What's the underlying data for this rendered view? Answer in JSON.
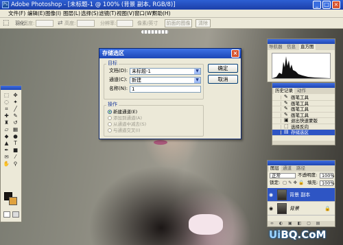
{
  "window": {
    "title": "Adobe Photoshop - [未标题-1 @ 100% (背景 副本, RGB/8)]",
    "app_icon": "ps-logo-icon"
  },
  "menu": [
    "文件(F)",
    "编辑(E)",
    "图像(I)",
    "图层(L)",
    "选择(S)",
    "滤镜(T)",
    "视图(V)",
    "窗口(W)",
    "帮助(H)"
  ],
  "options_bar": {
    "feather_label": "羽化:",
    "feather_value": "0 px",
    "width_label": "宽度:",
    "height_label": "高度:",
    "resolution_label": "分辨率:",
    "resolution_unit": "像素/英寸",
    "front_image_button": "前面的图像",
    "clear_button": "清除"
  },
  "navigator_panel": {
    "tabs": [
      "导航器",
      "信息",
      "直方图"
    ],
    "active_tab": "直方图"
  },
  "history_panel": {
    "tabs": [
      "历史记录",
      "动作"
    ],
    "items": [
      {
        "label": "画笔工具",
        "icon": "brush-icon"
      },
      {
        "label": "画笔工具",
        "icon": "brush-icon"
      },
      {
        "label": "画笔工具",
        "icon": "brush-icon"
      },
      {
        "label": "画笔工具",
        "icon": "brush-icon"
      },
      {
        "label": "退出快速蒙版",
        "icon": "mask-icon"
      },
      {
        "label": "选择反向",
        "icon": "selection-icon"
      },
      {
        "label": "存储选区",
        "icon": "save-icon"
      }
    ],
    "selected_index": 6
  },
  "layers_panel": {
    "tabs": [
      "图层",
      "通道",
      "路径"
    ],
    "blend_mode": "正常",
    "opacity_label": "不透明度:",
    "opacity_value": "100%",
    "lock_label": "锁定:",
    "fill_label": "填充:",
    "fill_value": "100%",
    "layers": [
      {
        "name": "背景 副本",
        "visible": true,
        "active": true
      },
      {
        "name": "背景",
        "visible": true,
        "active": false
      }
    ],
    "footer_icons": "∞ ◐ ▣ ◧ ▢ ▤"
  },
  "dialog": {
    "title": "存储选区",
    "group_target": "目标",
    "document_label": "文档(D):",
    "document_value": "未标题-1",
    "channel_label": "通道(C):",
    "channel_value": "新建",
    "name_label": "名称(N):",
    "name_value": "1",
    "group_operation": "操作",
    "operations": [
      "新建通道(E)",
      "添加到通道(A)",
      "从通道中减去(S)",
      "与通道交叉(I)"
    ],
    "selected_operation": 0,
    "ok_button": "确定",
    "cancel_button": "取消"
  },
  "colors": {
    "foreground": "#1a1613",
    "background": "#e0a23e",
    "title_blue": "#1d46b5"
  },
  "watermark": {
    "text_a": "Ui",
    "text_b": "BQ.CoM"
  }
}
